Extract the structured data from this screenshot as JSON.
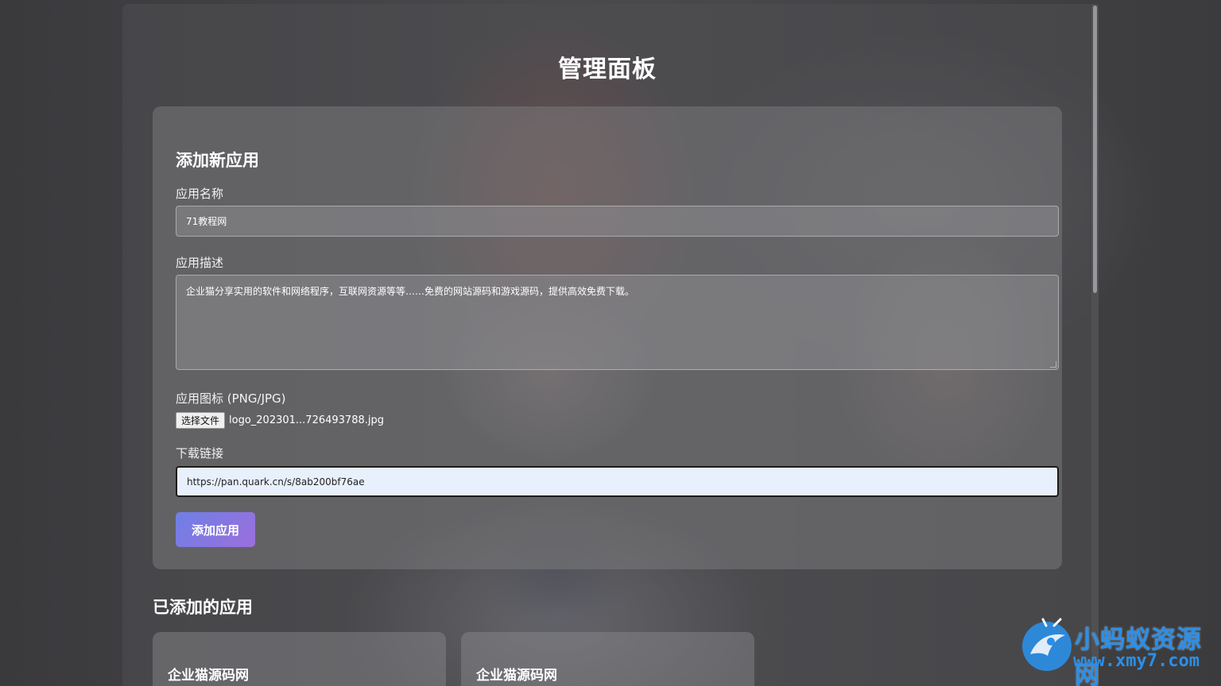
{
  "page": {
    "title": "管理面板"
  },
  "form": {
    "title": "添加新应用",
    "name_label": "应用名称",
    "name_value": "71教程网",
    "desc_label": "应用描述",
    "desc_value": "企业猫分享实用的软件和网络程序，互联网资源等等……免费的网站源码和游戏源码，提供高效免费下载。",
    "icon_label": "应用图标 (PNG/JPG)",
    "file_button": "选择文件",
    "file_name": "logo_202301...726493788.jpg",
    "link_label": "下载链接",
    "link_value": "https://pan.quark.cn/s/8ab200bf76ae",
    "submit_label": "添加应用"
  },
  "apps": {
    "title": "已添加的应用",
    "items": [
      {
        "name": "企业猫源码网"
      },
      {
        "name": "企业猫源码网"
      }
    ]
  },
  "watermark": {
    "title": "小蚂蚁资源网",
    "url": "www.xmy7.com"
  },
  "colors": {
    "accent_start": "#6f7fe6",
    "accent_end": "#9b6fdc",
    "watermark": "#2b8fe8"
  }
}
